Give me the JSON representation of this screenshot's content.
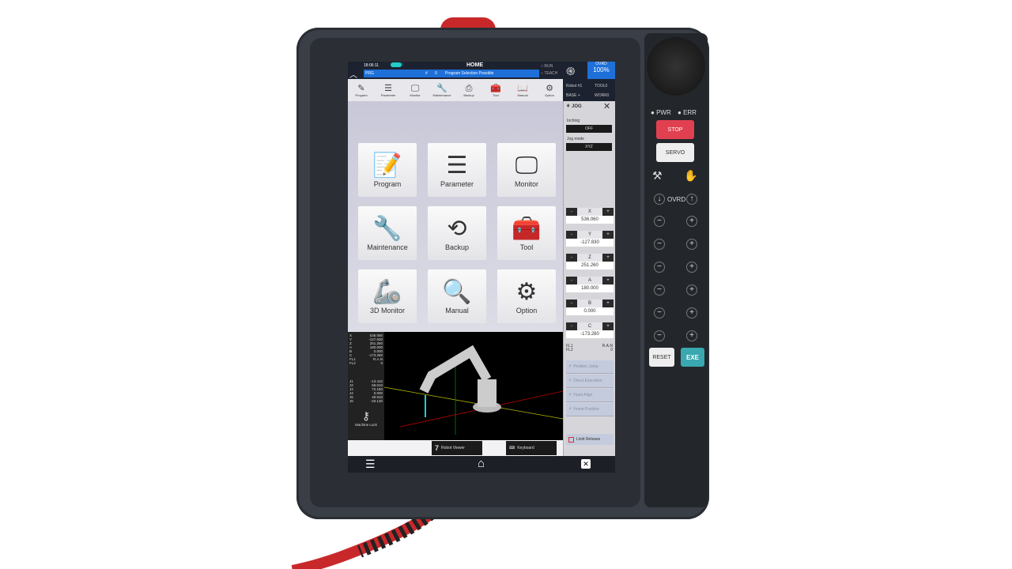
{
  "topbar": {
    "time": "18:06:11",
    "title": "HOME",
    "prg_label": "PRG",
    "hash": "#",
    "step": "0",
    "message": "Program Selection Possible",
    "run": "RUN",
    "teach": "TEACH",
    "ovrd_label": "OVRD",
    "ovrd_value": "100%",
    "robot": "Robot #1",
    "tool": "TOOL0",
    "base": "BASE +",
    "work": "WORK0"
  },
  "toolbar": [
    {
      "label": "Program",
      "icon": "program-icon"
    },
    {
      "label": "Parameter",
      "icon": "sliders-icon"
    },
    {
      "label": "Monitor",
      "icon": "monitor-icon"
    },
    {
      "label": "Maintenance",
      "icon": "wrench-icon"
    },
    {
      "label": "Backup",
      "icon": "backup-icon"
    },
    {
      "label": "Tool",
      "icon": "toolbox-icon"
    },
    {
      "label": "Manual",
      "icon": "book-icon"
    },
    {
      "label": "Option",
      "icon": "gear-icon"
    }
  ],
  "tiles": [
    {
      "label": "Program",
      "glyph": "📝"
    },
    {
      "label": "Parameter",
      "glyph": "☰"
    },
    {
      "label": "Monitor",
      "glyph": "🖵"
    },
    {
      "label": "Maintenance",
      "glyph": "🔧"
    },
    {
      "label": "Backup",
      "glyph": "⟲"
    },
    {
      "label": "Tool",
      "glyph": "🧰"
    },
    {
      "label": "3D Monitor",
      "glyph": "🦾"
    },
    {
      "label": "Manual",
      "glyph": "🔍"
    },
    {
      "label": "Option",
      "glyph": "⚙"
    }
  ],
  "viewer": {
    "pose": [
      [
        "X",
        "536.060"
      ],
      [
        "Y",
        "-127.830"
      ],
      [
        "Z",
        "251.260"
      ],
      [
        "A",
        "180.000"
      ],
      [
        "B",
        "0.000"
      ],
      [
        "C",
        "-173.280"
      ],
      [
        "FL1",
        "R.A.N"
      ],
      [
        "FL2",
        "0"
      ]
    ],
    "joints": [
      [
        "J1",
        "-13.410"
      ],
      [
        "J2",
        "58.010"
      ],
      [
        "J3",
        "72.180"
      ],
      [
        "J4",
        "0.000"
      ],
      [
        "J5",
        "49.810"
      ],
      [
        "J6",
        "-20.130"
      ]
    ],
    "machine_lock": "Machine Lock"
  },
  "tabs": {
    "robot_viewer": "Robot Viewer",
    "keyboard": "Keyboard"
  },
  "jog": {
    "title": "JOG",
    "inching_label": "Inching",
    "inching_value": "OFF",
    "mode_label": "Jog mode",
    "mode_value": "XYZ",
    "axes": [
      {
        "name": "X",
        "value": "536.060"
      },
      {
        "name": "Y",
        "value": "-127.830"
      },
      {
        "name": "Z",
        "value": "251.260"
      },
      {
        "name": "A",
        "value": "180.000"
      },
      {
        "name": "B",
        "value": "0.000"
      },
      {
        "name": "C",
        "value": "-173.280"
      }
    ],
    "minus": "-",
    "plus": "+",
    "fl1": "FL1",
    "fl2": "FL2",
    "fl1_value": "R.A.N",
    "fl2_value": "0",
    "buttons": [
      "Position Jump",
      "Direct Execution",
      "Hand Align",
      "Home Position"
    ],
    "limit_release": "Limit Release"
  },
  "hardware": {
    "pwr": "PWR",
    "err": "ERR",
    "stop": "STOP",
    "servo": "SERVO",
    "ovrd": "OVRD",
    "reset": "RESET",
    "exe": "EXE"
  },
  "colors": {
    "accent": "#1e6fd8",
    "stop": "#e04050",
    "exe": "#3aa8b0",
    "cable": "#c9282a"
  }
}
